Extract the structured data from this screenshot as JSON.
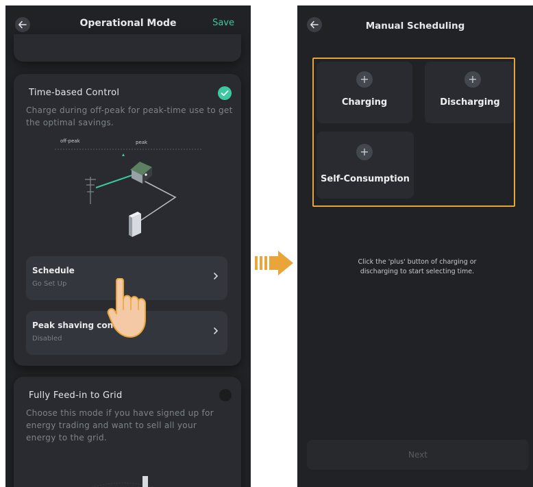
{
  "left_screen": {
    "header": {
      "title": "Operational Mode",
      "save_label": "Save"
    },
    "time_card": {
      "title": "Time-based Control",
      "description": "Charge during off-peak for peak-time use to get the optimal savings.",
      "diagram": {
        "off_peak_label": "off-peak",
        "peak_label": "peak"
      },
      "schedule": {
        "title": "Schedule",
        "subtitle": "Go Set Up"
      },
      "peak_shaving": {
        "title": "Peak shaving control",
        "subtitle": "Disabled"
      }
    },
    "feed_card": {
      "title": "Fully Feed-in to Grid",
      "description": "Choose this mode if you have signed up for energy trading and want to sell all your energy to the grid."
    }
  },
  "right_screen": {
    "header": {
      "title": "Manual Scheduling"
    },
    "options": [
      {
        "label": "Charging",
        "icon": "plus-icon"
      },
      {
        "label": "Discharging",
        "icon": "plus-icon"
      },
      {
        "label": "Self-Consumption",
        "icon": "plus-icon"
      }
    ],
    "hint": "Click the 'plus' button of charging or discharging to start selecting time.",
    "next_label": "Next"
  },
  "colors": {
    "background": "#202226",
    "card": "#292b30",
    "accent_green": "#3fc8a0",
    "highlight_orange": "#e9a53a"
  }
}
